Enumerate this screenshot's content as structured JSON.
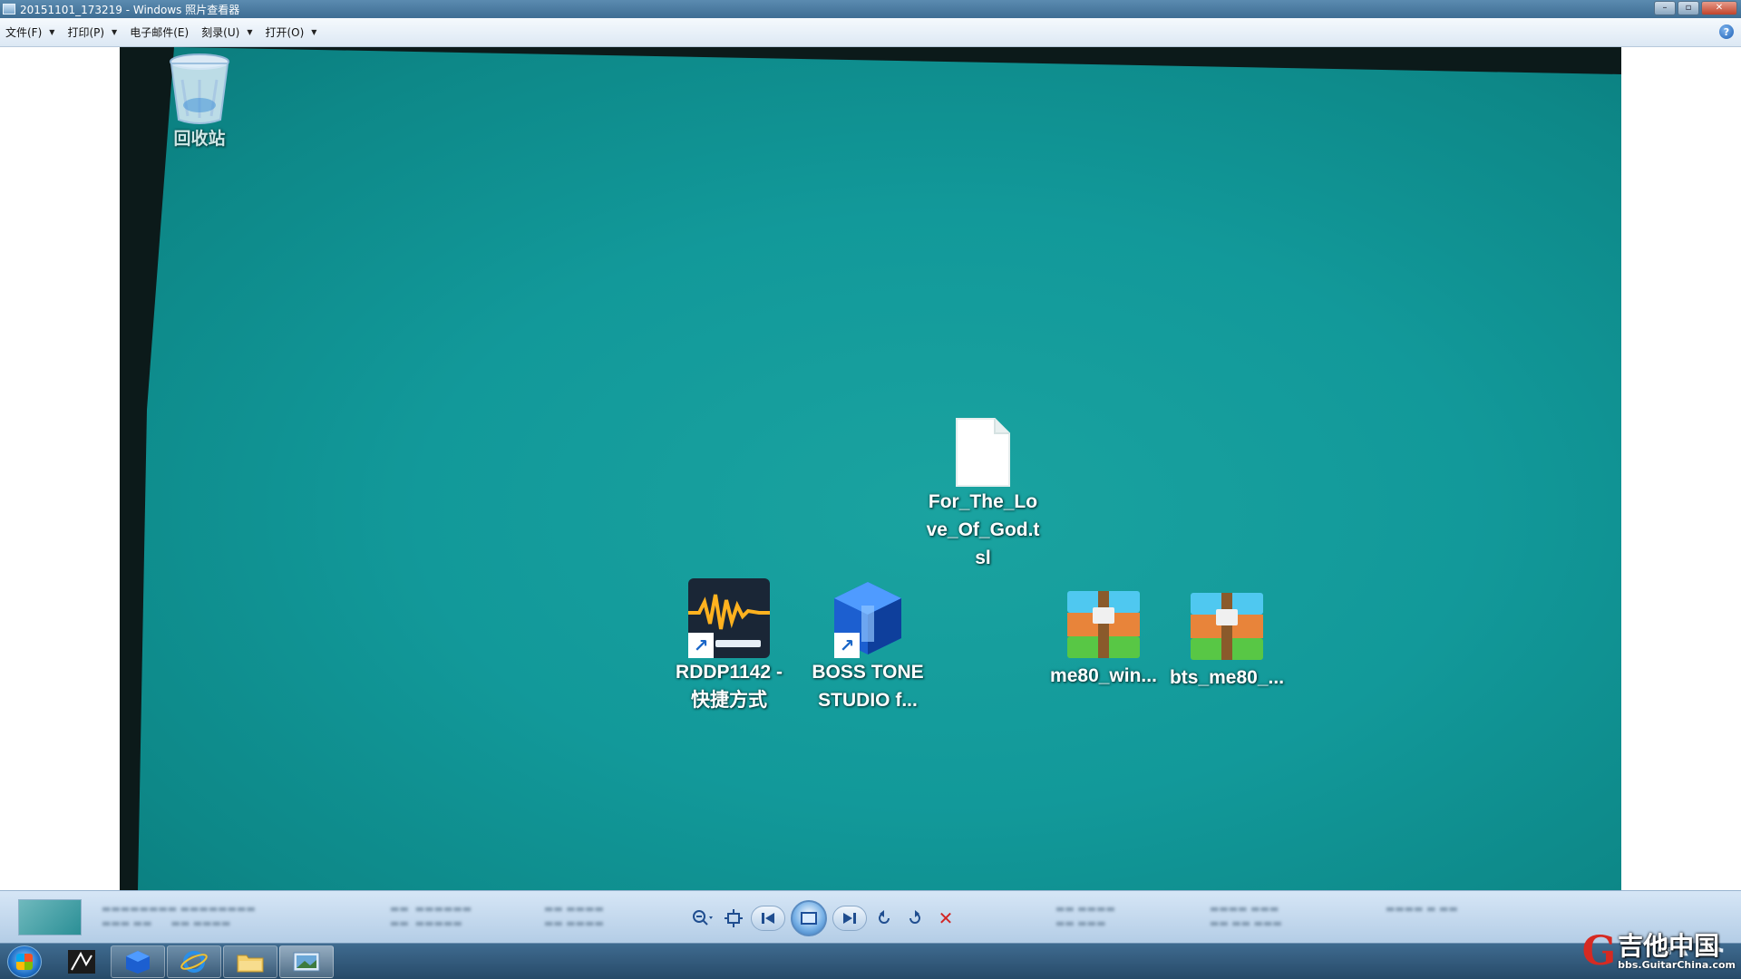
{
  "window": {
    "title": "20151101_173219 - Windows 照片查看器",
    "buttons": {
      "minimize": "–",
      "maximize": "▫",
      "close": "✕"
    }
  },
  "menu": {
    "items": [
      {
        "label": "文件(F)"
      },
      {
        "label": "打印(P)"
      },
      {
        "label": "电子邮件(E)"
      },
      {
        "label": "刻录(U)"
      },
      {
        "label": "打开(O)"
      }
    ],
    "help": "?"
  },
  "photo": {
    "desktop_icons": [
      {
        "name": "recycle-bin",
        "label": "回收站"
      },
      {
        "name": "text-file",
        "label": "For_The_Love_Of_God.tsl"
      },
      {
        "name": "rddp-shortcut",
        "label": "RDDP1142 - 快捷方式"
      },
      {
        "name": "boss-tone-studio",
        "label": "BOSS TONE STUDIO f..."
      },
      {
        "name": "me80-win-archive",
        "label": "me80_win..."
      },
      {
        "name": "bts-me80-archive",
        "label": "bts_me80_..."
      }
    ],
    "colors": {
      "desktop": "#14a09e"
    }
  },
  "controlbar": {
    "icons": [
      "zoom-icon",
      "fit-icon",
      "previous-icon",
      "slideshow-icon",
      "next-icon",
      "rotate-left-icon",
      "rotate-right-icon",
      "delete-icon"
    ]
  },
  "taskbar": {
    "apps": [
      "start-button",
      "app-icon-1",
      "app-icon-2",
      "ie-icon",
      "explorer-icon",
      "photo-viewer-icon"
    ]
  },
  "watermark": {
    "cn": "吉他中国",
    "url": "bbs.GuitarChina.com"
  }
}
